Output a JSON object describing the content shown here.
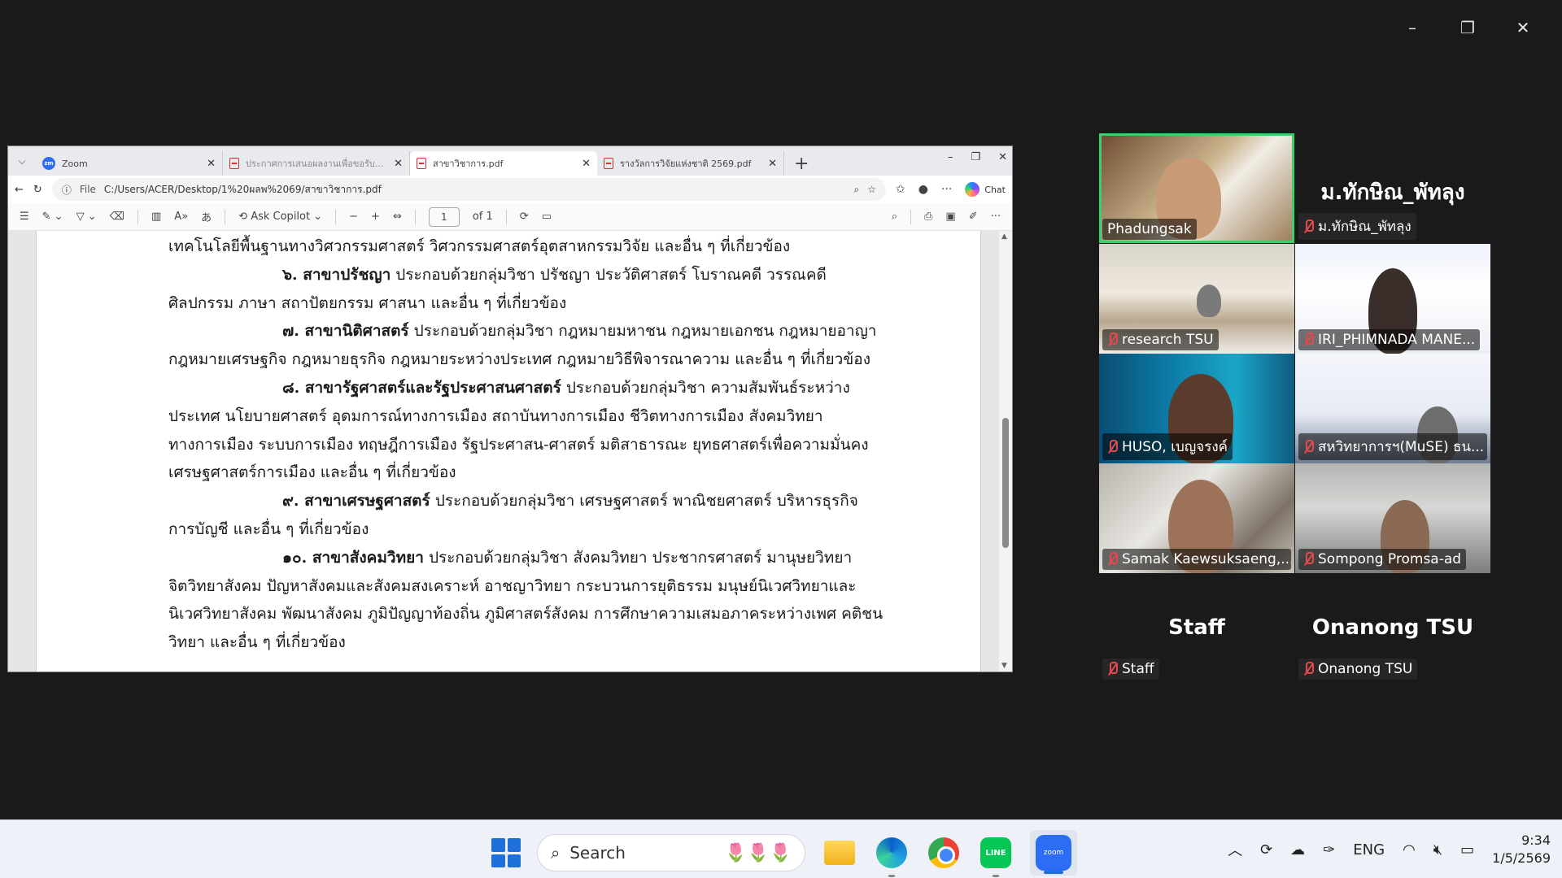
{
  "zoom_window": {
    "controls": [
      "–",
      "❐",
      "✕"
    ]
  },
  "browser": {
    "tabs": [
      {
        "label": "Zoom",
        "icon": "zoom-logo-icon"
      },
      {
        "label": "ประกาศการเสนอผลงานเพื่อขอรับรางวัล",
        "icon": "pdf-icon"
      },
      {
        "label": "สาขาวิชาการ.pdf",
        "icon": "pdf-icon"
      },
      {
        "label": "รางวัลการวิจัยแห่งชาติ 2569.pdf",
        "icon": "pdf-icon"
      }
    ],
    "new_tab": "+",
    "file_label": "File",
    "url": "C:/Users/ACER/Desktop/1%20ผลพ%2069/สาขาวิชาการ.pdf",
    "chat_label": "Chat",
    "toolbar": {
      "ask_copilot": "Ask Copilot",
      "zoom_out": "−",
      "zoom_in": "+",
      "page_current": "1",
      "page_total": "of 1"
    }
  },
  "document": {
    "lines": [
      {
        "indent": false,
        "bold": "",
        "text": "เทคโนโลยีพื้นฐานทางวิศวกรรมศาสตร์ วิศวกรรมศาสตร์อุตสาหกรรมวิจัย และอื่น ๆ ที่เกี่ยวข้อง"
      },
      {
        "indent": true,
        "bold": "๖. สาขาปรัชญา",
        "text": " ประกอบด้วยกลุ่มวิชา ปรัชญา ประวัติศาสตร์ โบราณคดี วรรณคดี"
      },
      {
        "indent": false,
        "bold": "",
        "text": "ศิลปกรรม ภาษา สถาปัตยกรรม ศาสนา และอื่น ๆ ที่เกี่ยวข้อง"
      },
      {
        "indent": true,
        "bold": "๗. สาขานิติศาสตร์",
        "text": " ประกอบด้วยกลุ่มวิชา กฎหมายมหาชน กฎหมายเอกชน กฎหมายอาญา"
      },
      {
        "indent": false,
        "bold": "",
        "text": "กฎหมายเศรษฐกิจ กฎหมายธุรกิจ กฎหมายระหว่างประเทศ กฎหมายวิธีพิจารณาความ และอื่น ๆ ที่เกี่ยวข้อง"
      },
      {
        "indent": true,
        "bold": "๘. สาขารัฐศาสตร์และรัฐประศาสนศาสตร์",
        "text": " ประกอบด้วยกลุ่มวิชา ความสัมพันธ์ระหว่าง"
      },
      {
        "indent": false,
        "bold": "",
        "text": "ประเทศ นโยบายศาสตร์ อุดมการณ์ทางการเมือง สถาบันทางการเมือง ชีวิตทางการเมือง สังคมวิทยา"
      },
      {
        "indent": false,
        "bold": "",
        "text": "ทางการเมือง ระบบการเมือง ทฤษฎีการเมือง รัฐประศาสน-ศาสตร์ มติสาธารณะ ยุทธศาสตร์เพื่อความมั่นคง"
      },
      {
        "indent": false,
        "bold": "",
        "text": "เศรษฐศาสตร์การเมือง และอื่น ๆ ที่เกี่ยวข้อง"
      },
      {
        "indent": true,
        "bold": "๙. สาขาเศรษฐศาสตร์",
        "text": " ประกอบด้วยกลุ่มวิชา เศรษฐศาสตร์ พาณิชยศาสตร์ บริหารธุรกิจ"
      },
      {
        "indent": false,
        "bold": "",
        "text": "การบัญชี และอื่น ๆ ที่เกี่ยวข้อง"
      },
      {
        "indent": true,
        "bold": "๑๐. สาขาสังคมวิทยา",
        "text": " ประกอบด้วยกลุ่มวิชา สังคมวิทยา ประชากรศาสตร์ มานุษยวิทยา"
      },
      {
        "indent": false,
        "bold": "",
        "text": "จิตวิทยาสังคม ปัญหาสังคมและสังคมสงเคราะห์ อาชญาวิทยา กระบวนการยุติธรรม มนุษย์นิเวศวิทยาและ"
      },
      {
        "indent": false,
        "bold": "",
        "text": "นิเวศวิทยาสังคม พัฒนาสังคม ภูมิปัญญาท้องถิ่น ภูมิศาสตร์สังคม การศึกษาความเสมอภาคระหว่างเพศ คติชน"
      },
      {
        "indent": false,
        "bold": "",
        "text": "วิทยา และอื่น ๆ ที่เกี่ยวข้อง"
      }
    ]
  },
  "gallery": {
    "tiles": [
      {
        "name": "Phadungsak",
        "muted": false,
        "speaker": true
      },
      {
        "name": "ม.ทักษิณ_พัทลุง",
        "muted": true,
        "video": false,
        "big": "ม.ทักษิณ_พัทลุง"
      },
      {
        "name": "research TSU",
        "muted": true
      },
      {
        "name": "IRI_PHIMNADA MANE...",
        "muted": true
      },
      {
        "name": "HUSO, เบญจรงค์",
        "muted": true
      },
      {
        "name": "สหวิทยาการฯ(MuSE) ธน...",
        "muted": true
      },
      {
        "name": "Samak Kaewsuksaeng,...",
        "muted": true
      },
      {
        "name": "Sompong Promsa-ad",
        "muted": true
      },
      {
        "name": "Staff",
        "muted": true,
        "video": false,
        "big": "Staff"
      },
      {
        "name": "Onanong TSU",
        "muted": true,
        "video": false,
        "big": "Onanong TSU"
      }
    ]
  },
  "taskbar": {
    "search_label": "Search",
    "lang": "ENG",
    "time": "9:34",
    "date": "1/5/2569"
  }
}
